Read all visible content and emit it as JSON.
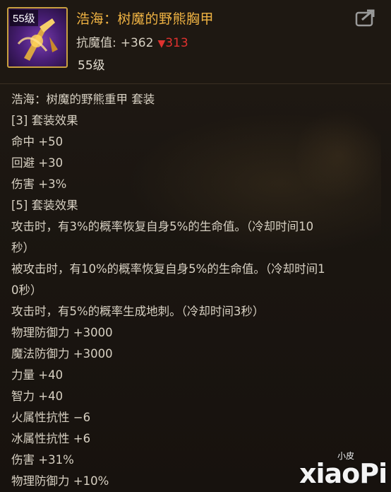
{
  "item": {
    "level_badge": "55级",
    "title": "浩海：树魔的野熊胸甲",
    "stat_label": "抗魔值:",
    "stat_value": "+362",
    "stat_arrow": "▼",
    "stat_diff": "313",
    "required_level": "55级",
    "share_icon": "share-icon"
  },
  "description_lines": [
    "浩海：树魔的野熊重甲 套装",
    "[3] 套装效果",
    "命中 +50",
    "回避 +30",
    "伤害 +3%",
    "[5] 套装效果",
    "攻击时，有3%的概率恢复自身5%的生命值。（冷却时间10",
    "秒）",
    "被攻击时，有10%的概率恢复自身5%的生命值。（冷却时间1",
    "0秒）",
    "攻击时，有5%的概率生成地刺。（冷却时间3秒）",
    "物理防御力 +3000",
    "魔法防御力 +3000",
    "力量 +40",
    "智力 +40",
    "火属性抗性 −6",
    "冰属性抗性 +6",
    "伤害 +31%",
    "物理防御力 +10%"
  ],
  "watermark": {
    "small": "小皮",
    "main": "xiaoPi"
  },
  "colors": {
    "title": "#f0b343",
    "diff": "#e0322f",
    "text": "#d7d0c2",
    "icon_border": "#c9a040"
  }
}
